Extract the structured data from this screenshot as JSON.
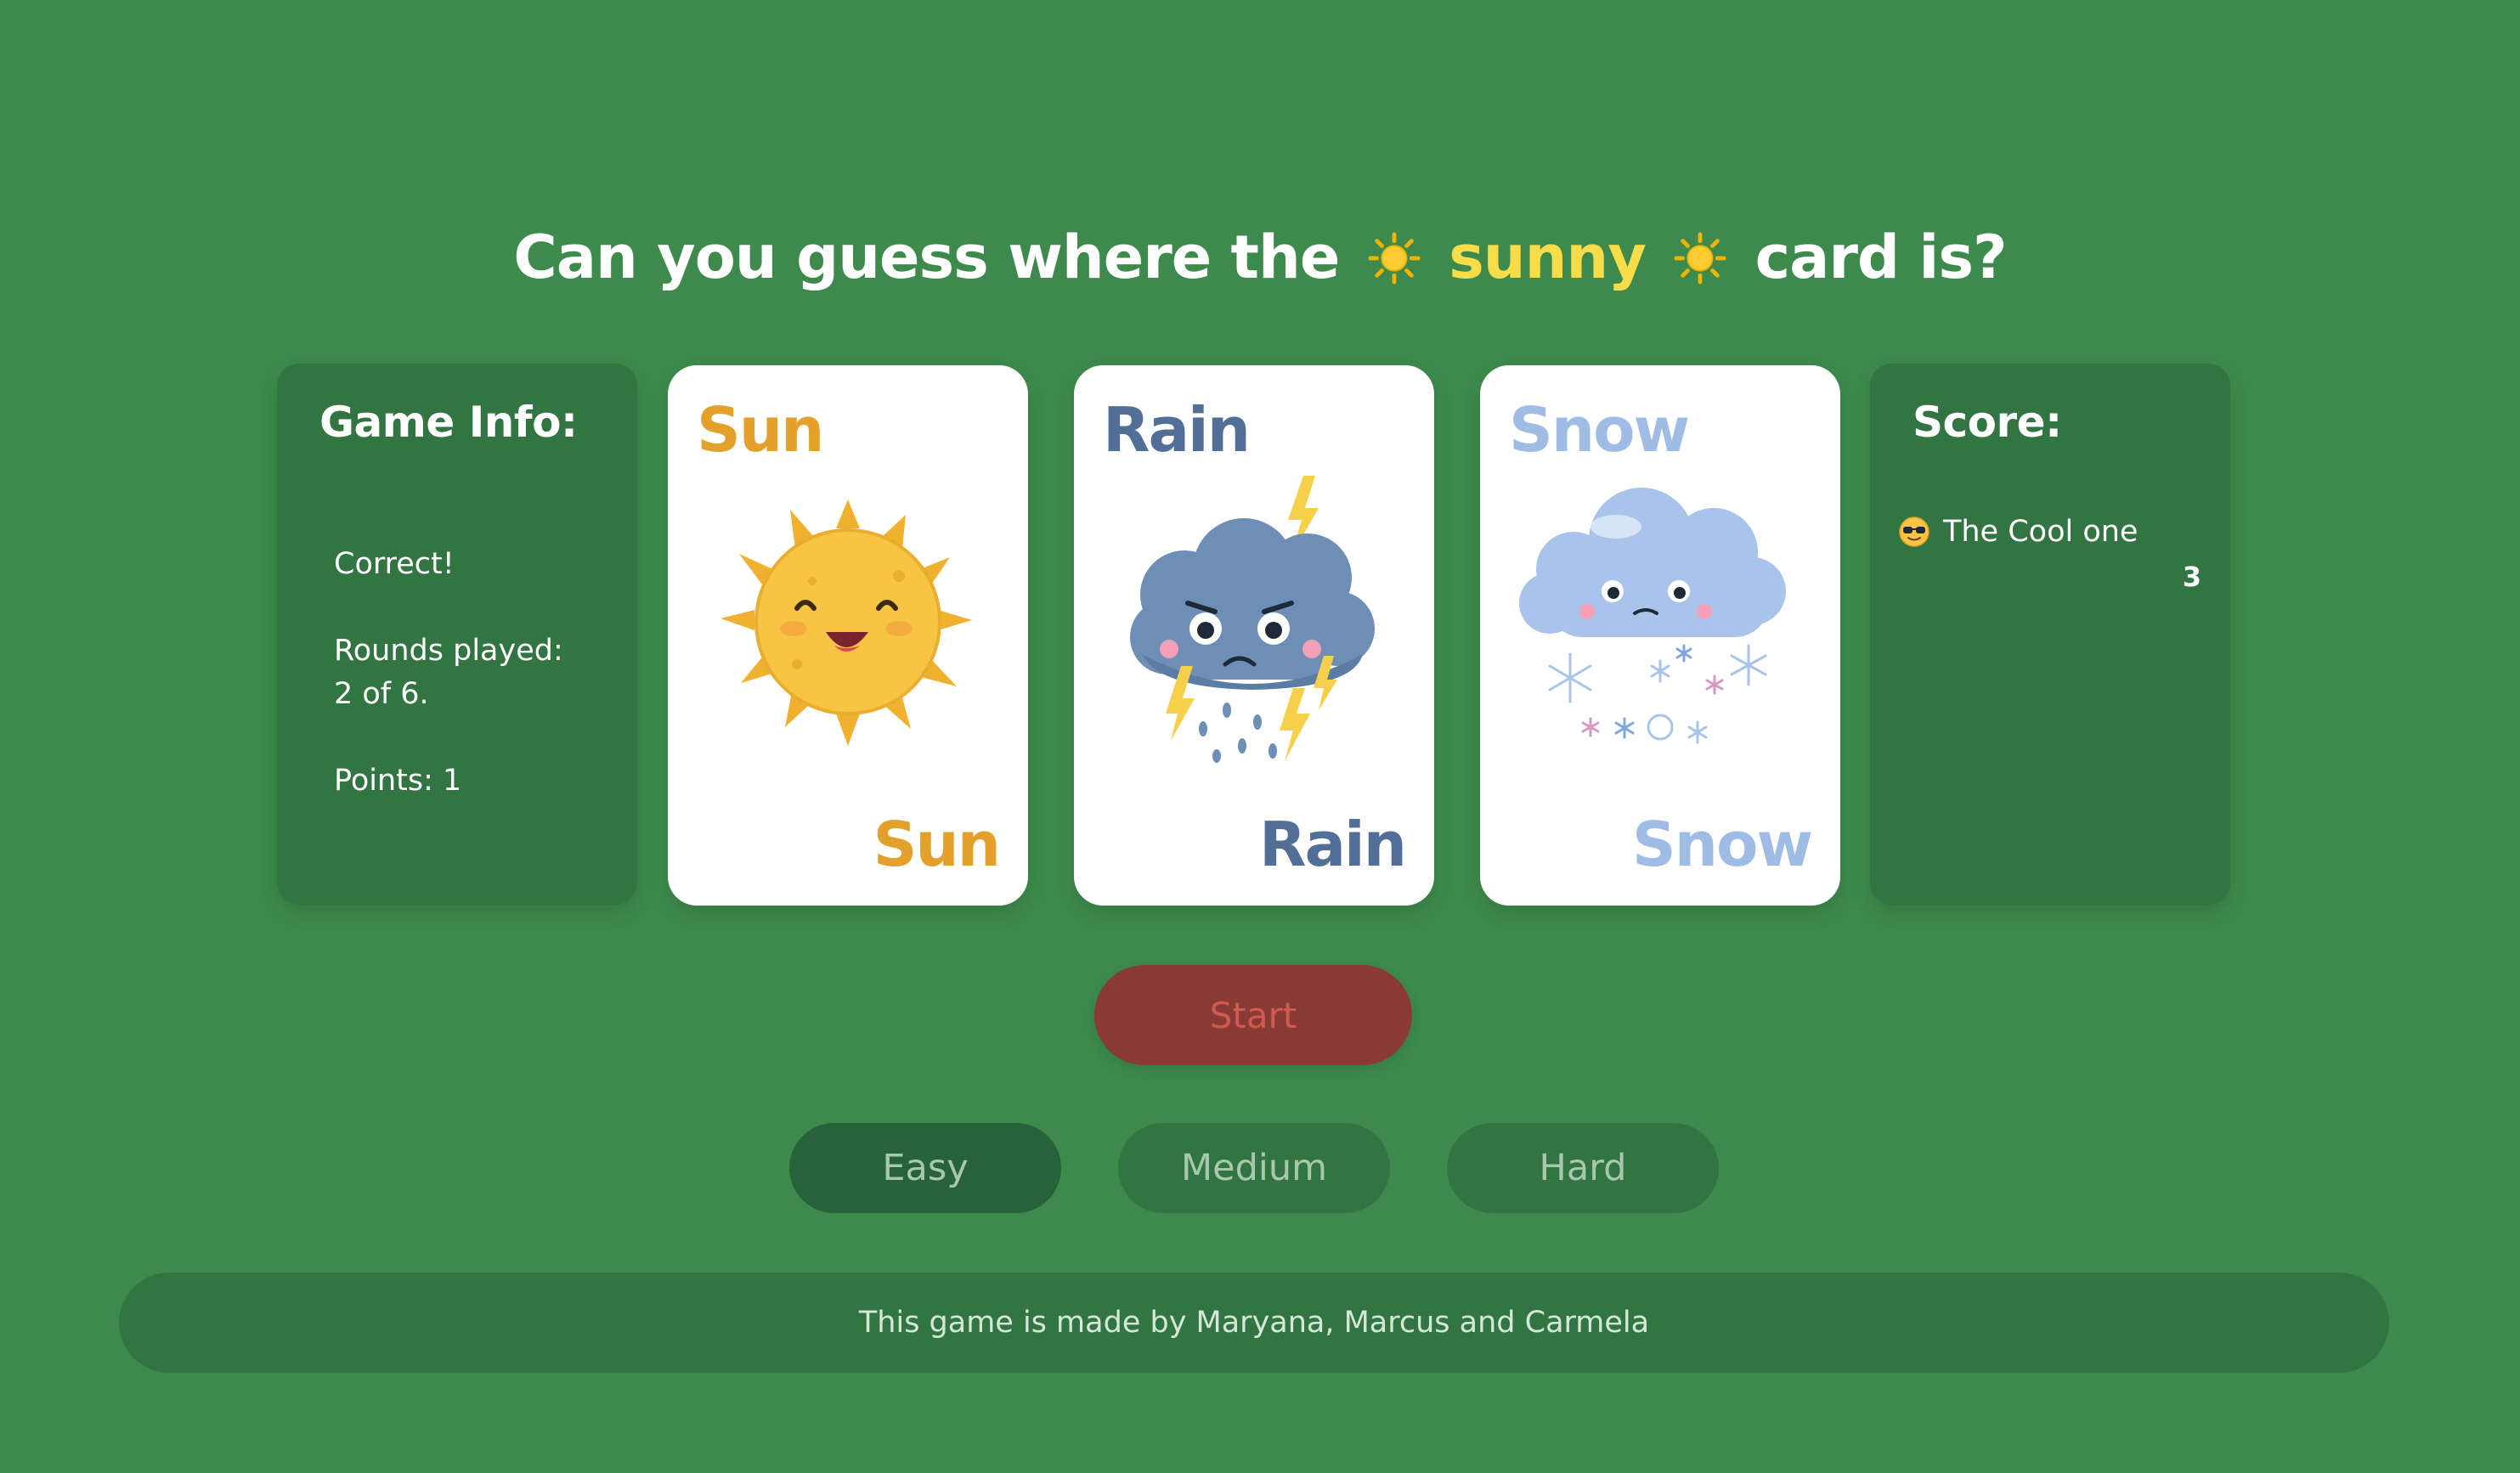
{
  "headline": {
    "prefix": "Can you guess where the",
    "weather": "sunny",
    "suffix": "card is?",
    "emoji_icon": "sun-emoji-icon"
  },
  "game_info": {
    "title": "Game Info:",
    "status": "Correct!",
    "rounds_label": "Rounds played:",
    "rounds_value": "2 of 6.",
    "points": "Points: 1"
  },
  "cards": [
    {
      "label": "Sun",
      "color": "#e3a12b",
      "icon": "sun-icon"
    },
    {
      "label": "Rain",
      "color": "#526f98",
      "icon": "storm-cloud-icon"
    },
    {
      "label": "Snow",
      "color": "#9fbde4",
      "icon": "snow-cloud-icon"
    }
  ],
  "score": {
    "title": "Score:",
    "player_icon": "sunglasses-face-icon",
    "player_name": "The Cool one",
    "player_points": "3"
  },
  "controls": {
    "start_label": "Start",
    "levels": [
      "Easy",
      "Medium",
      "Hard"
    ],
    "selected_level": "Easy"
  },
  "footer": {
    "credit": "This game is made by Maryana, Marcus and Carmela"
  },
  "colors": {
    "background": "#3d8a4c",
    "panel": "#327543",
    "highlight": "#f8dc4a",
    "start_button": "#8a3a34",
    "start_text": "#cf5a50"
  }
}
